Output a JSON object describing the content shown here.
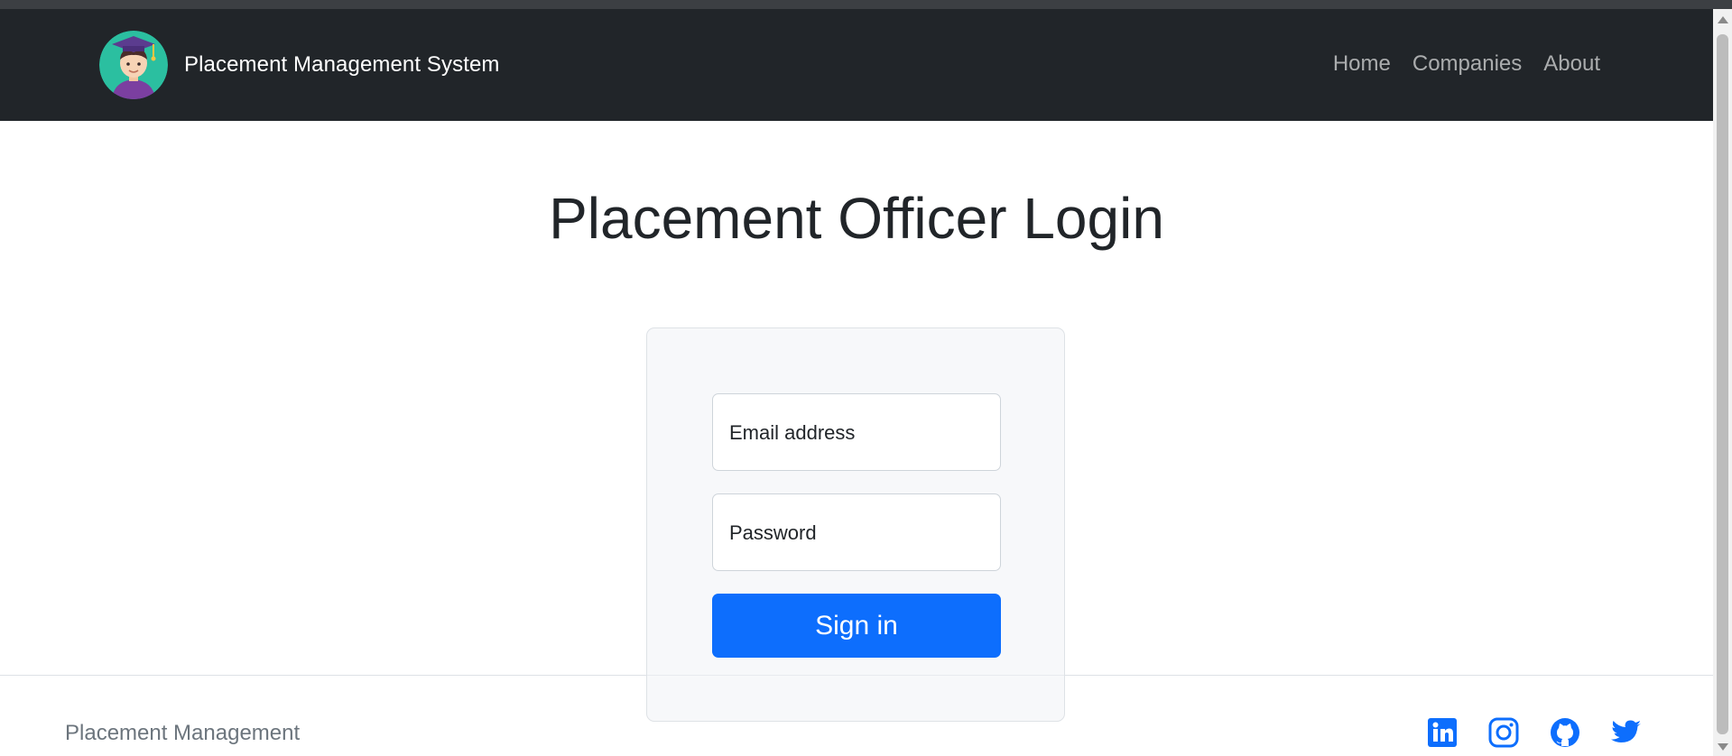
{
  "nav": {
    "brand": "Placement Management System",
    "links": [
      "Home",
      "Companies",
      "About"
    ]
  },
  "page": {
    "title": "Placement Officer Login"
  },
  "form": {
    "email_label": "Email address",
    "password_label": "Password",
    "submit_label": "Sign in"
  },
  "footer": {
    "text": "Placement Management",
    "social": [
      "linkedin-icon",
      "instagram-icon",
      "github-icon",
      "twitter-icon"
    ],
    "social_color": "#0d6efd"
  },
  "colors": {
    "navbar_bg": "#212529",
    "primary": "#0d6efd"
  }
}
